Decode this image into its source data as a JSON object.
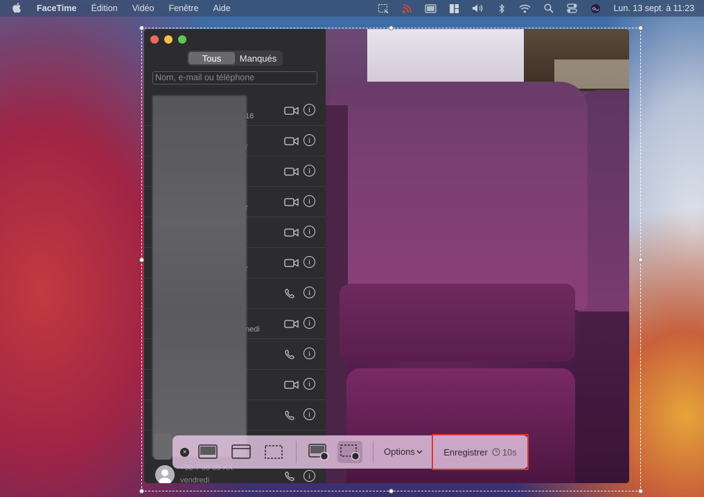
{
  "menubar": {
    "app_name": "FaceTime",
    "items": [
      "Édition",
      "Vidéo",
      "Fenêtre",
      "Aide"
    ],
    "clock": "Lun. 13 sept. à  11:23"
  },
  "facetime": {
    "tabs": [
      {
        "label": "Tous",
        "active": true
      },
      {
        "label": "Manqués",
        "active": false
      }
    ],
    "search_placeholder": "Nom, e-mail ou téléphone",
    "contacts": [
      {
        "detail": "16",
        "call_type": "video"
      },
      {
        "detail": "r",
        "call_type": "video"
      },
      {
        "detail": "",
        "call_type": "video"
      },
      {
        "detail": "r",
        "call_type": "video"
      },
      {
        "detail": "",
        "call_type": "video"
      },
      {
        "detail": "r",
        "call_type": "video"
      },
      {
        "detail": "",
        "call_type": "audio"
      },
      {
        "detail": "nedi",
        "call_type": "video"
      },
      {
        "detail": "",
        "call_type": "audio"
      },
      {
        "detail": "",
        "call_type": "video"
      },
      {
        "detail": "",
        "call_type": "audio"
      }
    ],
    "last_contact": {
      "name": "+33 7 65 05 XX",
      "day": "vendredi",
      "call_type": "audio"
    },
    "info_glyph": "i"
  },
  "capture_toolbar": {
    "close_glyph": "×",
    "modes": [
      {
        "icon": "capture-entire-screen-icon",
        "active": false
      },
      {
        "icon": "capture-window-icon",
        "active": false
      },
      {
        "icon": "capture-selection-icon",
        "active": false
      },
      {
        "icon": "record-entire-screen-icon",
        "active": false
      },
      {
        "icon": "record-selection-icon",
        "active": true
      }
    ],
    "options_label": "Options",
    "record_label": "Enregistrer",
    "timer_label": "10s",
    "highlight_color": "#d83a2f"
  }
}
